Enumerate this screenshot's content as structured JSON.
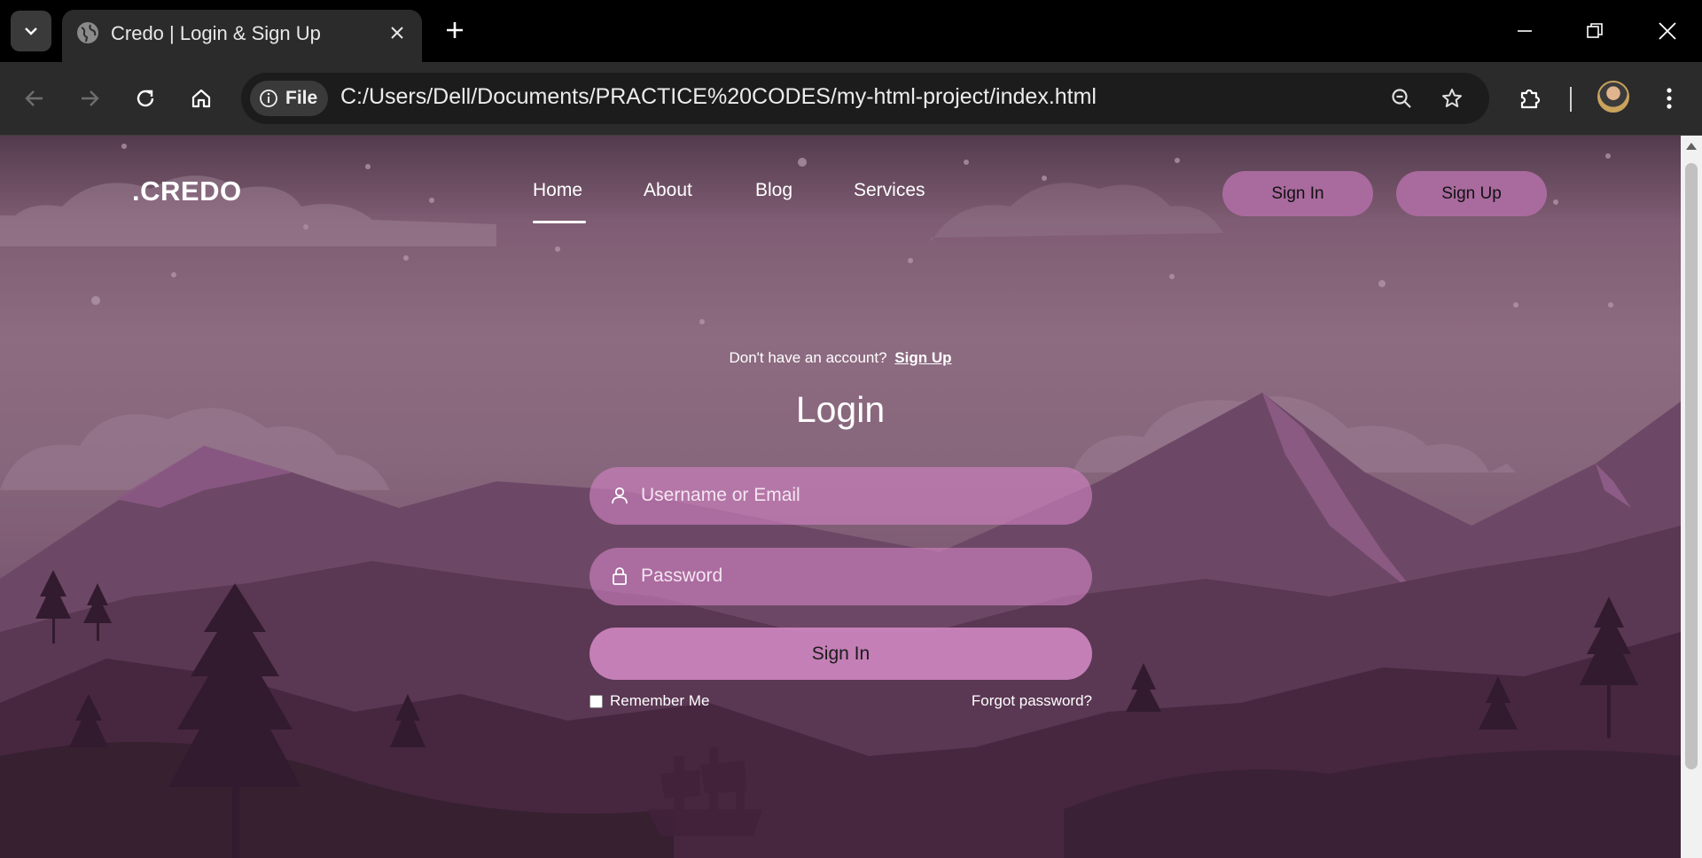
{
  "browser": {
    "tab_title": "Credo | Login & Sign Up",
    "site_chip_label": "File",
    "url": "C:/Users/Dell/Documents/PRACTICE%20CODES/my-html-project/index.html"
  },
  "site": {
    "logo": ".CREDO",
    "nav": [
      {
        "label": "Home",
        "active": true
      },
      {
        "label": "About",
        "active": false
      },
      {
        "label": "Blog",
        "active": false
      },
      {
        "label": "Services",
        "active": false
      }
    ],
    "header_buttons": {
      "sign_in": "Sign In",
      "sign_up": "Sign Up"
    }
  },
  "login": {
    "hint_text": "Don't have an account?",
    "hint_link": "Sign Up",
    "title": "Login",
    "username_placeholder": "Username or Email",
    "password_placeholder": "Password",
    "submit_label": "Sign In",
    "remember_label": "Remember Me",
    "remember_checked": false,
    "forgot_label": "Forgot password?"
  },
  "colors": {
    "button_bg": "#a96a9e",
    "field_bg": "#d282c3",
    "sky_top": "#4e3647",
    "mountain_dark": "#3a1f36"
  },
  "icons": {
    "tab_search": "chevron-down-icon",
    "favicon": "globe-icon",
    "tab_close": "close-icon",
    "new_tab": "plus-icon",
    "back": "arrow-left-icon",
    "forward": "arrow-right-icon",
    "reload": "reload-icon",
    "home": "home-icon",
    "site_info": "info-icon",
    "zoom": "zoom-out-icon",
    "bookmark": "star-icon",
    "extensions": "puzzle-icon",
    "menu": "kebab-menu-icon",
    "username": "user-icon",
    "password": "lock-icon"
  }
}
